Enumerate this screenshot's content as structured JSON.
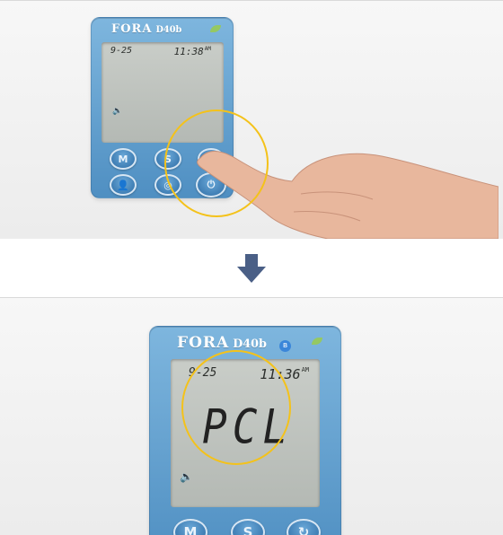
{
  "top_panel": {
    "device": {
      "brand": "FORA",
      "model": "D40b",
      "date": "9-25",
      "time": "11:38",
      "ampm": "AM",
      "speaker_icon": "speaker-icon",
      "buttons": {
        "m_label": "M",
        "s_label": "S",
        "r_label": "↻",
        "p_label": "👤",
        "c_label": "◎",
        "power_label": "⏻"
      }
    },
    "pointer": "pressing-hand"
  },
  "transition": {
    "arrow_icon": "down-arrow-icon",
    "arrow_color": "#4a5f86"
  },
  "bottom_panel": {
    "device": {
      "brand": "FORA",
      "model": "D40b",
      "bluetooth_label": "ʙ",
      "date": "9-25",
      "time": "11:36",
      "ampm": "AM",
      "readout": "PCL",
      "speaker_icon": "speaker-icon",
      "buttons": {
        "m_label": "M",
        "s_label": "S",
        "r_label": "↻"
      }
    }
  },
  "colors": {
    "highlight": "#f4c21a",
    "device_blue": "#5f9ccc",
    "lcd": "#c1c5c0"
  }
}
